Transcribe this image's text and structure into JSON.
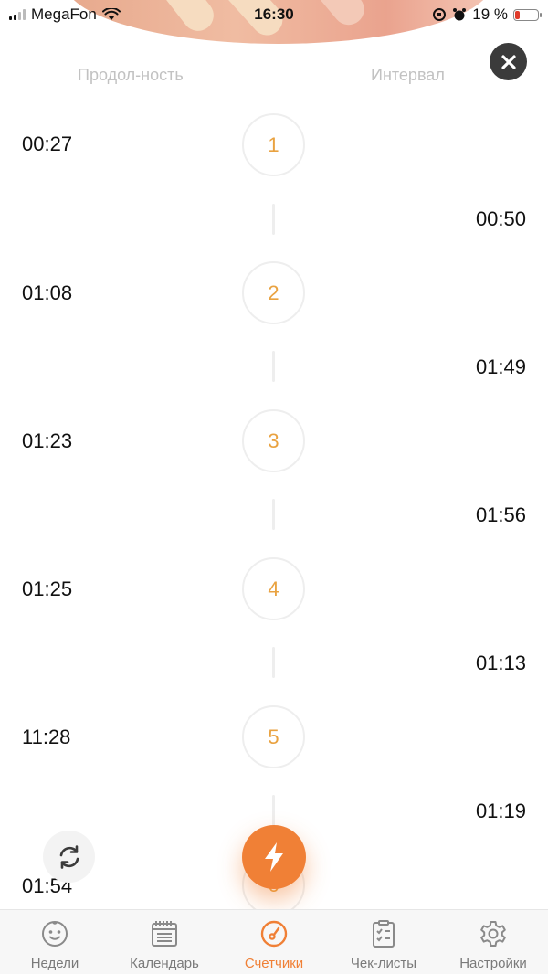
{
  "status_bar": {
    "carrier": "MegaFon",
    "time": "16:30",
    "battery_percent": "19 %",
    "battery_level": 0.19
  },
  "columns": {
    "duration_label": "Продол-ность",
    "interval_label": "Интервал"
  },
  "contractions": [
    {
      "number": "1",
      "duration": "00:27",
      "interval": "00:50"
    },
    {
      "number": "2",
      "duration": "01:08",
      "interval": "01:49"
    },
    {
      "number": "3",
      "duration": "01:23",
      "interval": "01:56"
    },
    {
      "number": "4",
      "duration": "01:25",
      "interval": "01:13"
    },
    {
      "number": "5",
      "duration": "11:28",
      "interval": "01:19"
    },
    {
      "number": "6",
      "duration": "01:54",
      "interval": ""
    }
  ],
  "tabs": [
    {
      "label": "Недели",
      "icon": "baby-face-icon"
    },
    {
      "label": "Календарь",
      "icon": "calendar-icon"
    },
    {
      "label": "Счетчики",
      "icon": "counter-gauge-icon",
      "active": true
    },
    {
      "label": "Чек-листы",
      "icon": "checklist-icon"
    },
    {
      "label": "Настройки",
      "icon": "gear-icon"
    }
  ],
  "colors": {
    "accent": "#f08036",
    "number": "#e9a240",
    "close_button": "#3b3b3b",
    "inactive": "#7a7a7a"
  }
}
